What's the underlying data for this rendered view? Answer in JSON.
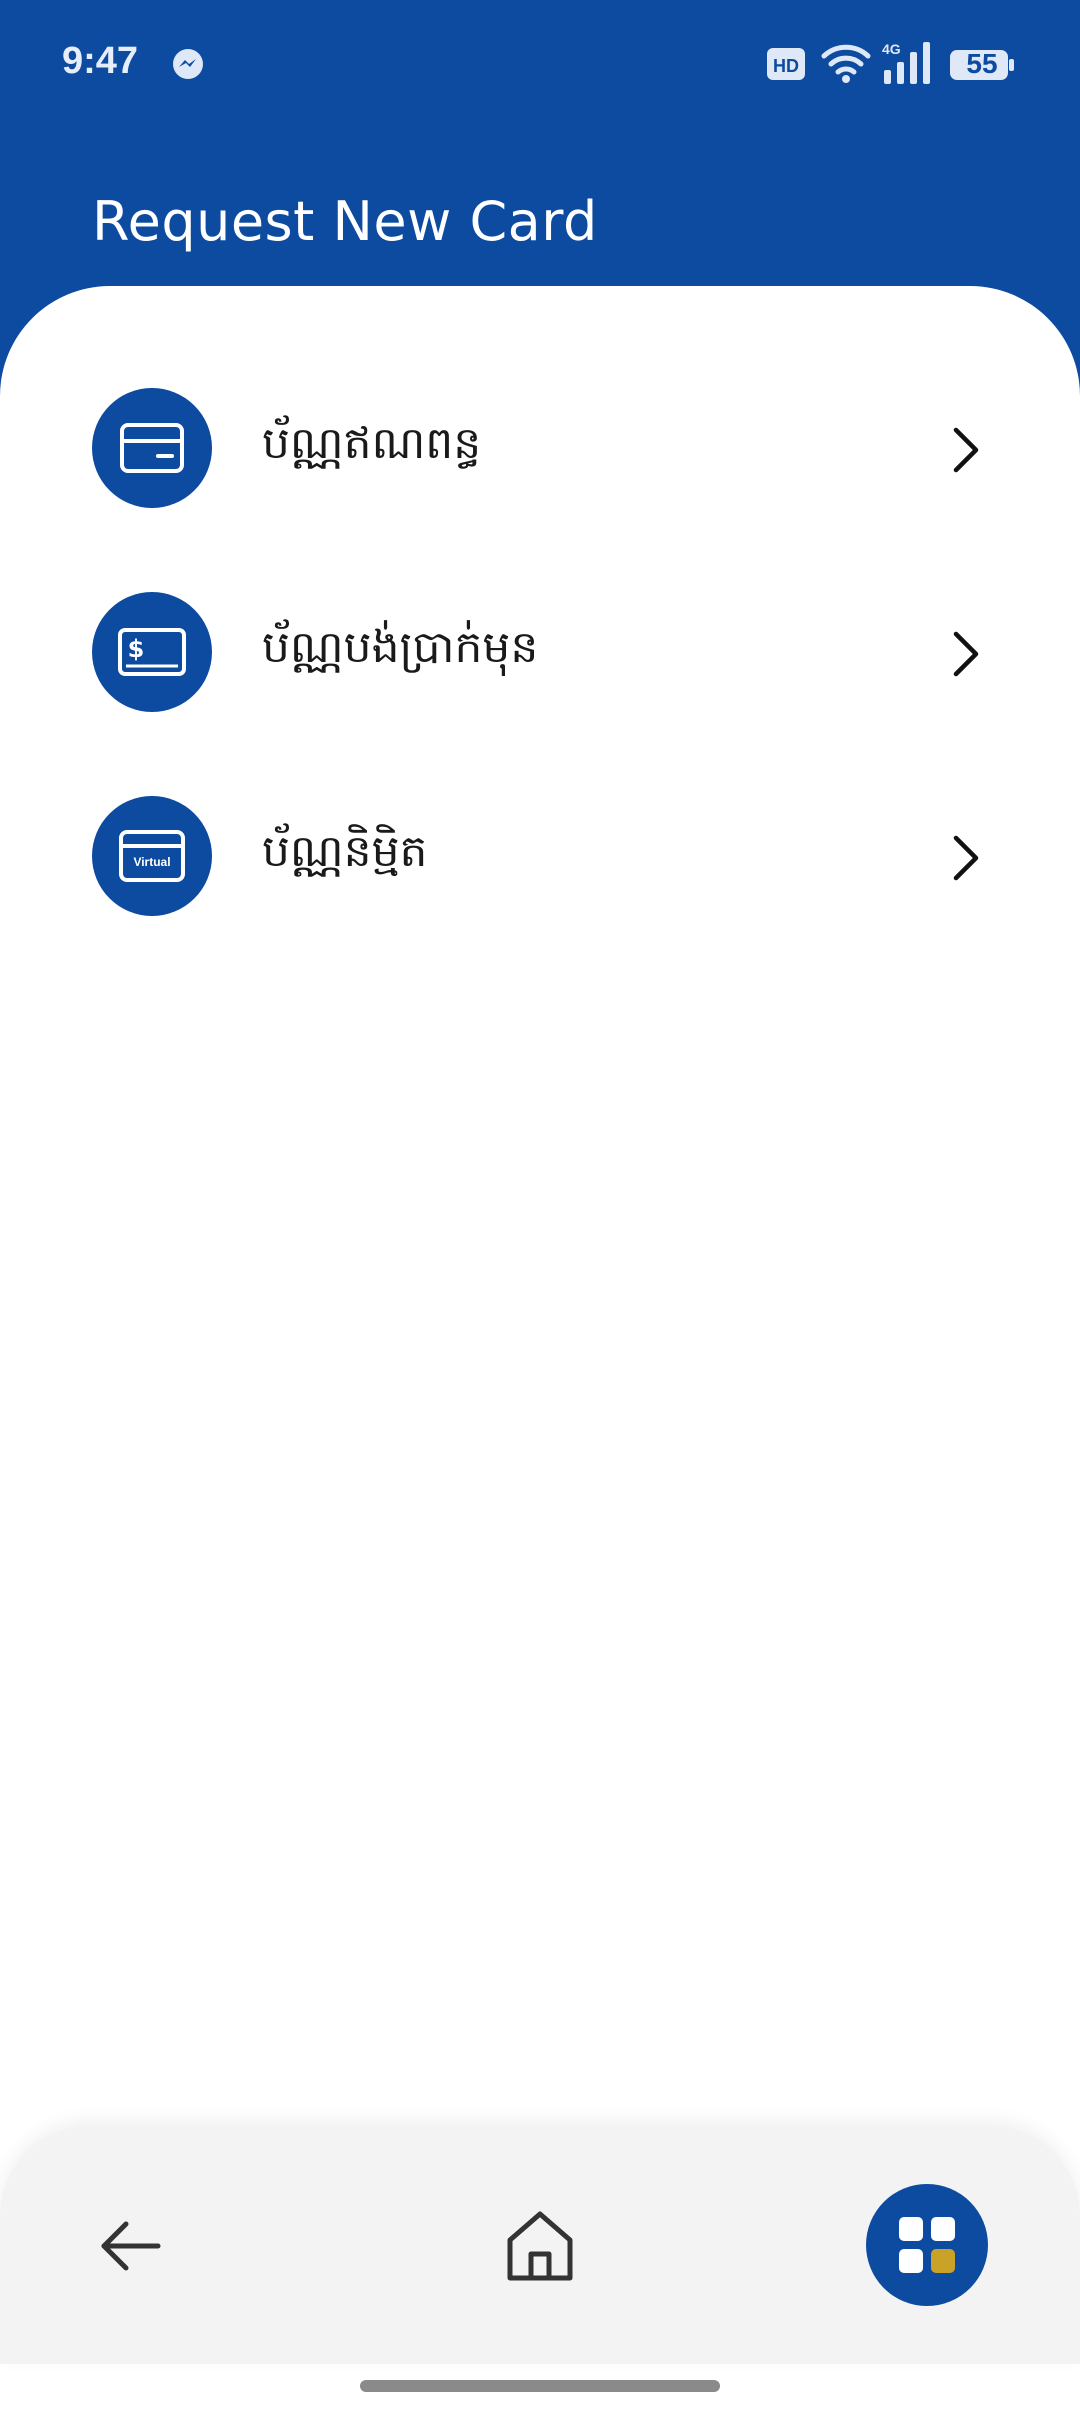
{
  "status_bar": {
    "time": "9:47",
    "battery_level": "55",
    "network_label": "4G",
    "hd_label": "HD",
    "icons": [
      "messenger-icon",
      "hd-icon",
      "wifi-icon",
      "signal-icon",
      "battery-icon"
    ]
  },
  "header": {
    "title": "Request New Card"
  },
  "menu": {
    "items": [
      {
        "label": "ប័ណ្ណឥណពន្ធ",
        "icon": "debit-card-icon"
      },
      {
        "label": "ប័ណ្ណបង់ប្រាក់មុន",
        "icon": "prepaid-card-icon"
      },
      {
        "label": "ប័ណ្ណនិម្មិត",
        "icon": "virtual-card-icon",
        "icon_text": "Virtual"
      }
    ]
  },
  "bottom_nav": {
    "items": [
      "back-icon",
      "home-icon",
      "apps-grid-icon"
    ]
  },
  "colors": {
    "primary": "#0d4ba0",
    "accent": "#c9a227",
    "nav_background": "#f3f3f3"
  }
}
